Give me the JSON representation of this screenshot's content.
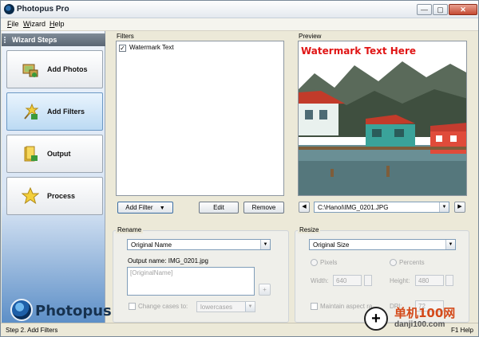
{
  "window": {
    "title": "Photopus Pro",
    "min": "—",
    "max": "▢",
    "close": "✕"
  },
  "menu": [
    {
      "key": "F",
      "rest": "ile"
    },
    {
      "key": "W",
      "rest": "izard"
    },
    {
      "key": "H",
      "rest": "elp"
    }
  ],
  "wizard": {
    "header": "Wizard Steps",
    "steps": [
      {
        "label": "Add Photos"
      },
      {
        "label": "Add Filters"
      },
      {
        "label": "Output"
      },
      {
        "label": "Process"
      }
    ],
    "logo_text": "Photopus"
  },
  "filters": {
    "label": "Filters",
    "items": [
      {
        "label": "Watermark Text",
        "checked": "✓"
      }
    ],
    "add_filter": "Add Filter",
    "edit": "Edit",
    "remove": "Remove"
  },
  "preview": {
    "label": "Preview",
    "watermark": "Watermark Text Here",
    "path": "C:\\Hanoi\\IMG_0201.JPG",
    "prev": "◀",
    "next": "▶"
  },
  "rename": {
    "label": "Rename",
    "mode": "Original Name",
    "output_label": "Output name:",
    "output_value": "IMG_0201.jpg",
    "pattern_placeholder": "[OriginalName]",
    "insert_button": "+",
    "change_case_label": "Change cases to:",
    "case_value": "lowercases"
  },
  "resize": {
    "label": "Resize",
    "mode": "Original Size",
    "pixels_label": "Pixels",
    "percents_label": "Percents",
    "width_label": "Width:",
    "width_value": "640",
    "height_label": "Height:",
    "height_value": "480",
    "maintain_label": "Maintain aspect ra",
    "dpi_label": "DPI:",
    "dpi_value": "72"
  },
  "status": {
    "text": "Step 2. Add Filters",
    "help": "F1 Help"
  },
  "watermark_site": {
    "name": "单机100网",
    "url": "danji100.com"
  }
}
